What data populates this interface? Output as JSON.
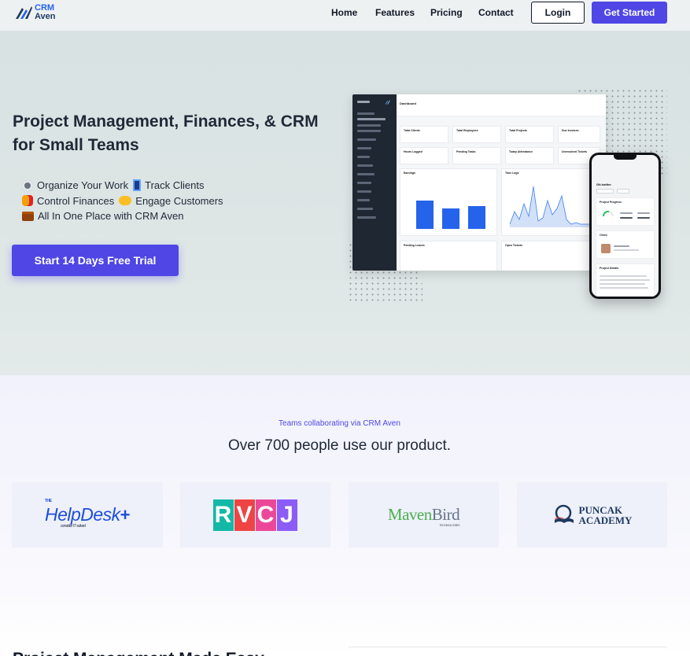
{
  "brand": {
    "line1": "CRM",
    "line2": "Aven"
  },
  "nav": {
    "links": [
      "Home",
      "Features",
      "Pricing",
      "Contact"
    ],
    "login": "Login",
    "get_started": "Get Started"
  },
  "hero": {
    "title": "Project Management, Finances, & CRM for Small Teams",
    "features": [
      {
        "icon": "paperclip-icon",
        "text": "Organize Your Work"
      },
      {
        "icon": "phone-icon",
        "text": "Track Clients"
      },
      {
        "icon": "money-icon",
        "text": "Control Finances"
      },
      {
        "icon": "handshake-icon",
        "text": "Engage Customers"
      },
      {
        "icon": "briefcase-icon",
        "text": "All In One Place with CRM Aven"
      }
    ],
    "cta": "Start 14 Days Free Trial"
  },
  "dashboard_preview": {
    "title": "Dashboard",
    "cards": [
      "Total Clients",
      "Total Employees",
      "Total Projects",
      "Due Invoices",
      "Hours Logged",
      "Pending Tasks",
      "Today Attendance",
      "Unresolved Tickets"
    ],
    "panels": [
      "Earnings",
      "Time Logs",
      "Pending Leaves",
      "Open Tickets"
    ],
    "earnings_values": [
      0.82,
      0.58,
      0.65
    ]
  },
  "phone_preview": {
    "title": "Git-twitter",
    "cards": [
      "Project Progress",
      "Client",
      "Project Details"
    ]
  },
  "section2": {
    "kicker": "Teams collaborating via CRM Aven",
    "title": "Over 700 people use our product."
  },
  "partners": {
    "helpdesk": {
      "small": "THE",
      "name": "HelpDesk",
      "plus": "+",
      "tag": "consider IT solved"
    },
    "rvcj": [
      "R",
      "V",
      "C",
      "J"
    ],
    "maven": {
      "green": "Maven",
      "grey": "Bird",
      "tag": "TECHNOLOGIES"
    },
    "puncak": {
      "line1": "PUNCAK",
      "line2": "ACADEMY"
    }
  },
  "bottom": {
    "heading": "Project Management Made Easy"
  },
  "colors": {
    "primary": "#4f46e5",
    "hero_bg": "#dbe3e3",
    "chart_blue": "#2563eb"
  }
}
